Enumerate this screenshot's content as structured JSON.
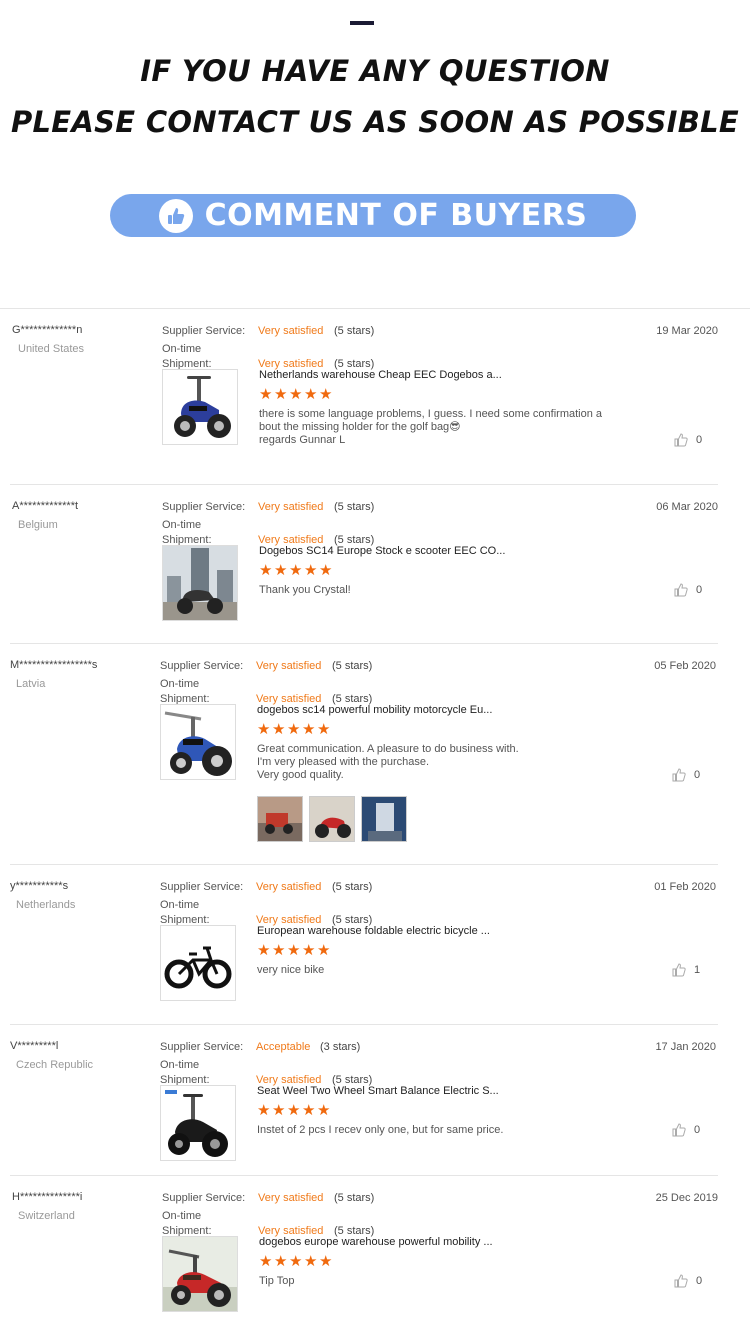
{
  "header": {
    "line1": "IF YOU HAVE ANY QUESTION",
    "line2": "PLEASE CONTACT US AS SOON AS POSSIBLE",
    "banner": "COMMENT OF BUYERS"
  },
  "labels": {
    "supplier_service": "Supplier Service:",
    "ontime_1": "On-time",
    "ontime_2": "Shipment:"
  },
  "reviews": [
    {
      "name": "G*************n",
      "country": "United States",
      "date": "19 Mar 2020",
      "service_rating": "Very satisfied",
      "service_stars": "(5 stars)",
      "shipment_rating": "Very satisfied",
      "shipment_stars": "(5 stars)",
      "product": "Netherlands warehouse Cheap EEC Dogebos a...",
      "comment": "there is some language problems, I guess. I need some confirmation a\nbout the missing holder for the golf bag😎\nregards Gunnar L",
      "likes": "0",
      "image_icon": "blue-scooter"
    },
    {
      "name": "A*************t",
      "country": "Belgium",
      "date": "06 Mar 2020",
      "service_rating": "Very satisfied",
      "service_stars": "(5 stars)",
      "shipment_rating": "Very satisfied",
      "shipment_stars": "(5 stars)",
      "product": "Dogebos SC14 Europe Stock e scooter EEC CO...",
      "comment": "Thank you Crystal!",
      "likes": "0",
      "image_icon": "scooter-city"
    },
    {
      "name": "M*****************s",
      "country": "Latvia",
      "date": "05 Feb 2020",
      "service_rating": "Very satisfied",
      "service_stars": "(5 stars)",
      "shipment_rating": "Very satisfied",
      "shipment_stars": "(5 stars)",
      "product": "dogebos sc14 powerful mobility motorcycle Eu...",
      "comment": "Great communication. A pleasure to do business with.\nI'm very pleased with the purchase.\nVery good quality.",
      "likes": "0",
      "image_icon": "blue-motorcycle"
    },
    {
      "name": "y***********s",
      "country": "Netherlands",
      "date": "01 Feb 2020",
      "service_rating": "Very satisfied",
      "service_stars": "(5 stars)",
      "shipment_rating": "Very satisfied",
      "shipment_stars": "(5 stars)",
      "product": "European warehouse foldable electric bicycle ...",
      "comment": "very nice bike",
      "likes": "1",
      "image_icon": "electric-bicycle"
    },
    {
      "name": "V*********l",
      "country": "Czech Republic",
      "date": "17 Jan 2020",
      "service_rating": "Acceptable",
      "service_stars": "(3 stars)",
      "shipment_rating": "Very satisfied",
      "shipment_stars": "(5 stars)",
      "product": "Seat Weel Two Wheel Smart Balance Electric S...",
      "comment": "Instet of 2 pcs I recev only one, but for same price.",
      "likes": "0",
      "image_icon": "black-scooter"
    },
    {
      "name": "H**************i",
      "country": "Switzerland",
      "date": "25 Dec 2019",
      "service_rating": "Very satisfied",
      "service_stars": "(5 stars)",
      "shipment_rating": "Very satisfied",
      "shipment_stars": "(5 stars)",
      "product": "dogebos europe warehouse powerful mobility ...",
      "comment": "Tip Top",
      "likes": "0",
      "image_icon": "red-scooter"
    }
  ],
  "colors": {
    "accent": "#f07a1a",
    "banner": "#79a6ec",
    "star": "#f06a0f"
  }
}
